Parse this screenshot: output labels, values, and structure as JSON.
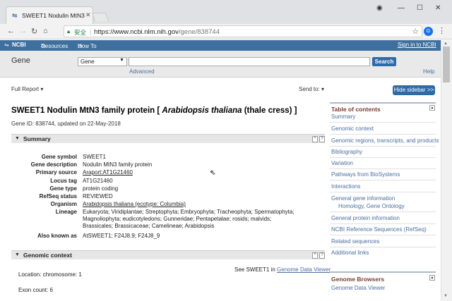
{
  "browser": {
    "tab_title": "SWEET1 Nodulin MtN3",
    "secure_label": "安全",
    "url_host": "https://www.ncbi.nlm.nih.gov",
    "url_path": "/gene/838744"
  },
  "ncbi_bar": {
    "logo": "NCBI",
    "resources": "Resources",
    "howto": "How To",
    "signin": "Sign in to NCBI"
  },
  "search": {
    "db_label": "Gene",
    "db_selected": "Gene",
    "search_button": "Search",
    "advanced": "Advanced",
    "help": "Help"
  },
  "toolbar": {
    "full_report": "Full Report",
    "send_to": "Send to:",
    "hide_sidebar": "Hide sidebar >>"
  },
  "record": {
    "title_pre": "SWEET1   Nodulin MtN3 family protein [",
    "title_species": "Arabidopsis thaliana",
    "title_post": "(thale cress) ]",
    "gene_id_line": "Gene ID: 838744, updated on 22-May-2018"
  },
  "summary": {
    "heading": "Summary",
    "rows": [
      {
        "k": "Gene symbol",
        "v": "SWEET1"
      },
      {
        "k": "Gene description",
        "v": "Nodulin MtN3 family protein"
      },
      {
        "k": "Primary source",
        "v": "Araport:AT1G21460"
      },
      {
        "k": "Locus tag",
        "v": "AT1G21460"
      },
      {
        "k": "Gene type",
        "v": "protein coding"
      },
      {
        "k": "RefSeq status",
        "v": "REVIEWED"
      },
      {
        "k": "Organism",
        "v": "Arabidopsis thaliana (ecotype: Columbia)"
      },
      {
        "k": "Lineage",
        "v": "Eukaryota; Viridiplantae; Streptophyta; Embryophyta; Tracheophyta; Spermatophyta; Magnoliophyta; eudicotyledons; Gunneridae; Pentapetalae; rosids; malvids; Brassicales; Brassicaceae; Camelineae; Arabidopsis"
      },
      {
        "k": "Also known as",
        "v": "AtSWEET1; F24J8.9; F24J8_9"
      }
    ]
  },
  "genomic_context": {
    "heading": "Genomic context",
    "see_pre": "See SWEET1 in",
    "see_link": "Genome Data Viewer",
    "location": "Location: chromosome: 1",
    "exon": "Exon count: 6"
  },
  "toc": {
    "heading": "Table of contents",
    "items": [
      "Summary",
      "Genomic context",
      "Genomic regions, transcripts, and products",
      "Bibliography",
      "Variation",
      "Pathways from BioSystems",
      "Interactions",
      "General gene information",
      "Homology,  Gene Ontology",
      "General protein information",
      "NCBI Reference Sequences (RefSeq)",
      "Related sequences",
      "Additional links"
    ]
  },
  "genome_browsers": {
    "heading": "Genome Browsers",
    "item": "Genome Data Viewer"
  },
  "colors": {
    "ncbi_blue": "#3e6f9f",
    "link": "#4a6d9d",
    "button_blue": "#2e6aa6"
  }
}
